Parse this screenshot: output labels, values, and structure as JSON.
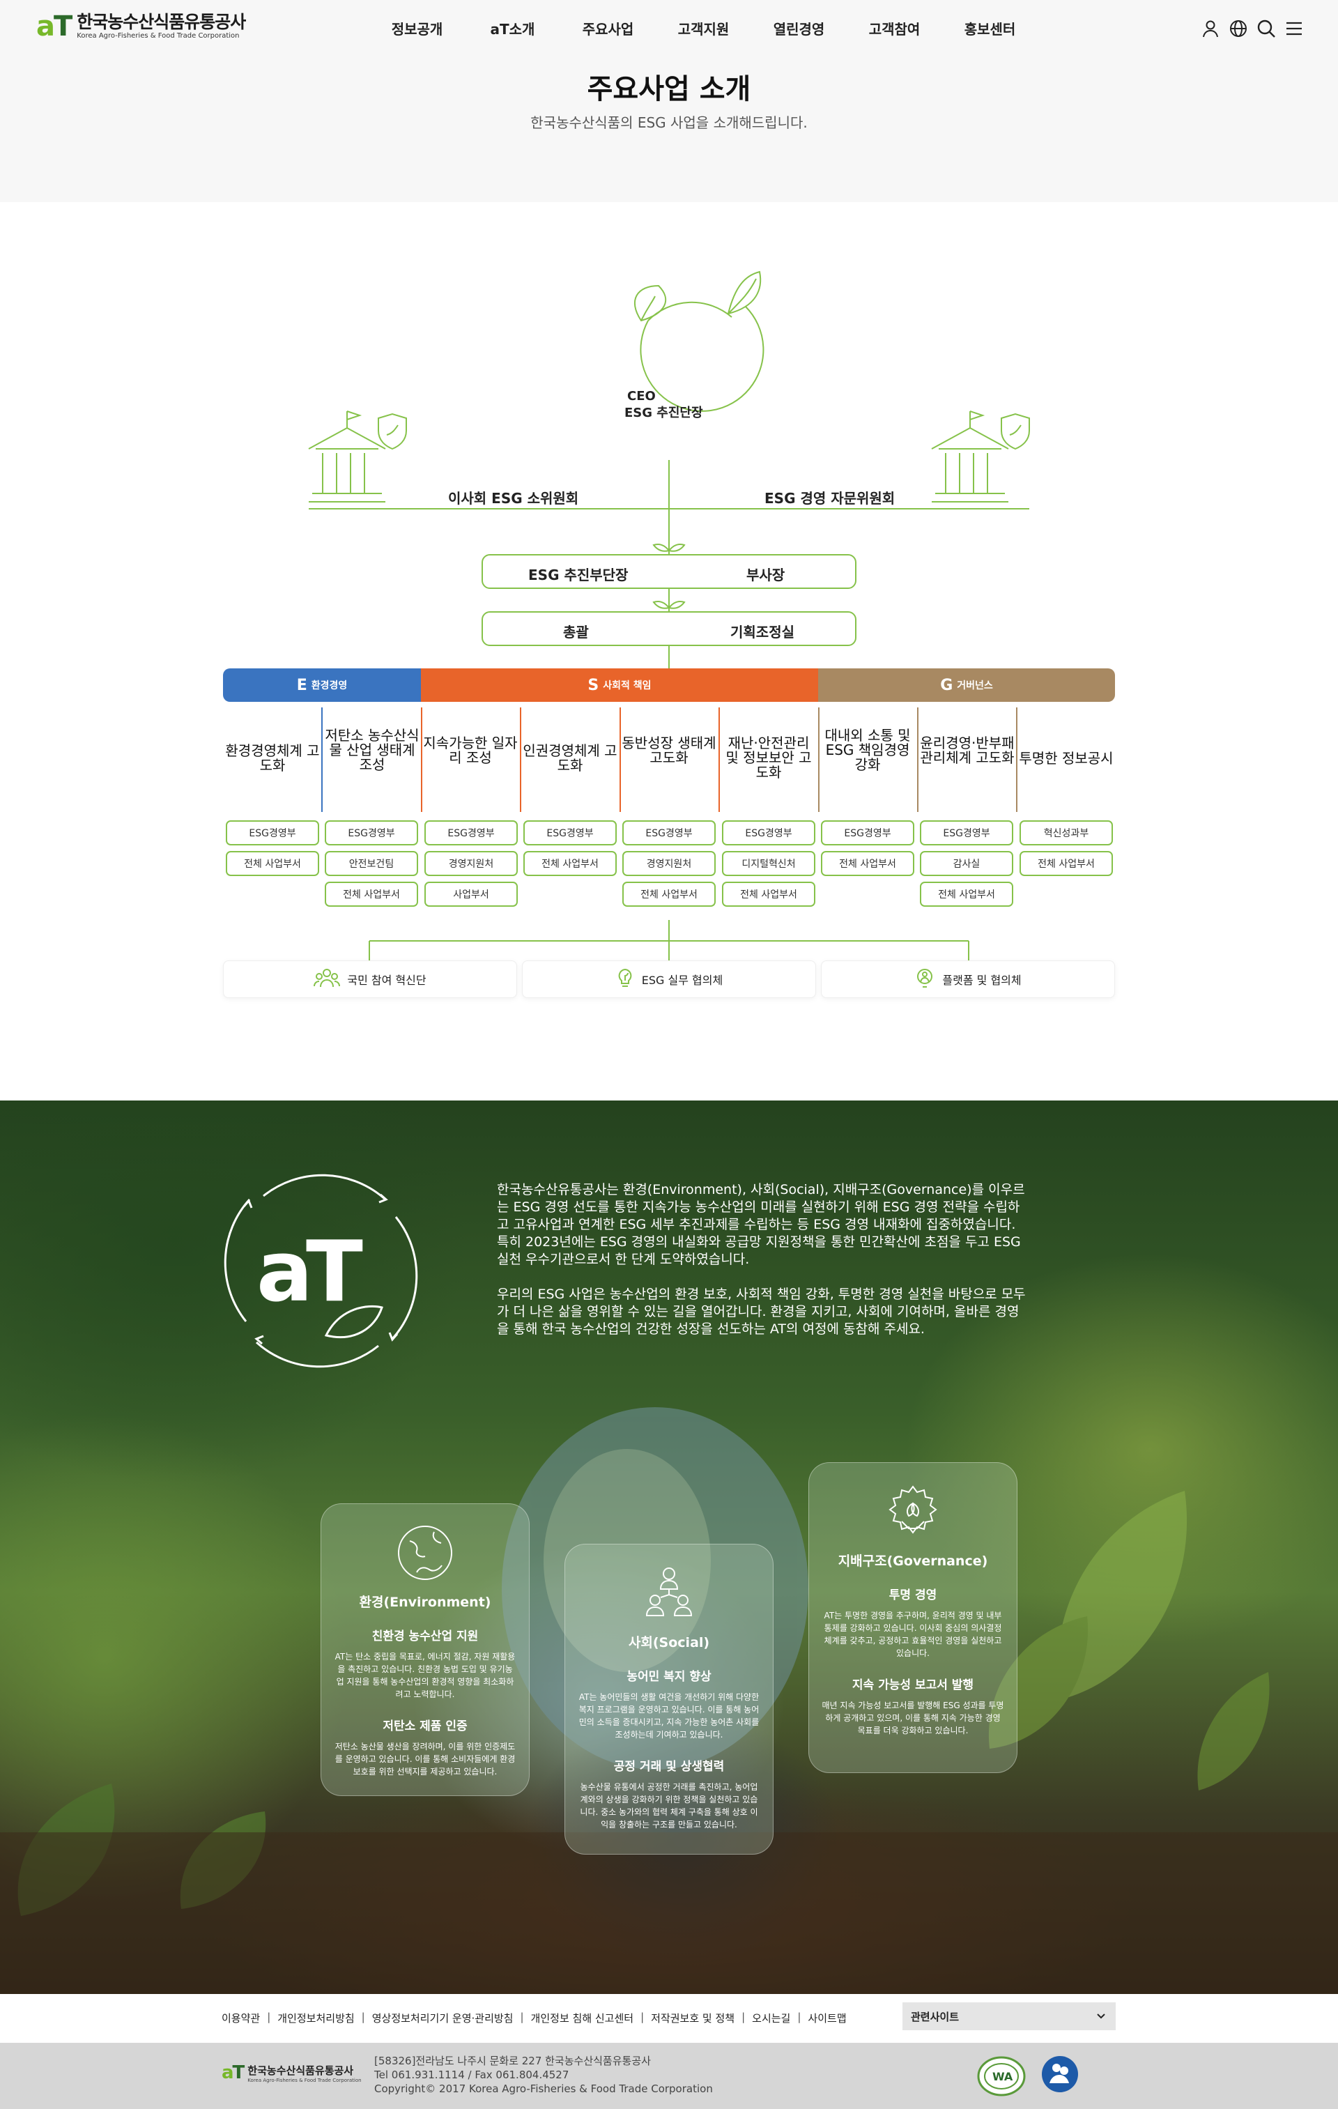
{
  "header": {
    "logo_mark_a": "a",
    "logo_mark_t": "T",
    "logo_ko": "한국농수산식품유통공사",
    "logo_en": "Korea Agro-Fisheries & Food Trade Corporation",
    "nav": [
      "정보공개",
      "aT소개",
      "주요사업",
      "고객지원",
      "열린경영",
      "고객참여",
      "홍보센터"
    ],
    "icons": [
      "user-icon",
      "globe-icon",
      "search-icon",
      "menu-icon"
    ],
    "page_title": "주요사업 소개",
    "page_subtitle": "한국농수산식품의 ESG 사업을 소개해드립니다."
  },
  "org": {
    "ceo_line1": "CEO",
    "ceo_line2": "ESG 추진단장",
    "left_committee": "이사회 ESG 소위원회",
    "right_committee": "ESG 경영 자문위원회",
    "row1_left": "ESG 추진부단장",
    "row1_right": "부사장",
    "row2_left": "총괄",
    "row2_right": "기획조정실",
    "categories": [
      {
        "letter": "E",
        "label": "환경경영",
        "color": "#3a74c0"
      },
      {
        "letter": "S",
        "label": "사회적 책임",
        "color": "#e8642a"
      },
      {
        "letter": "G",
        "label": "거버넌스",
        "color": "#a88962"
      }
    ],
    "tasks": [
      "환경경영체계 고도화",
      "저탄소 농수산식물 산업 생태계 조성",
      "지속가능한 일자리 조성",
      "인권경영체계 고도화",
      "동반성장 생태계 고도화",
      "재난·안전관리 및 정보보안 고도화",
      "대내외 소통 및 ESG 책임경영 강화",
      "윤리경영·반부패 관리체계 고도화",
      "투명한 정보공시"
    ],
    "depts": [
      [
        "ESG경영부",
        "전체 사업부서"
      ],
      [
        "ESG경영부",
        "안전보건팀",
        "전체 사업부서"
      ],
      [
        "ESG경영부",
        "경영지원처",
        "사업부서"
      ],
      [
        "ESG경영부",
        "전체 사업부서"
      ],
      [
        "ESG경영부",
        "경영지원처",
        "전체 사업부서"
      ],
      [
        "ESG경영부",
        "디지털혁신처",
        "전체 사업부서"
      ],
      [
        "ESG경영부",
        "전체 사업부서"
      ],
      [
        "ESG경영부",
        "감사실",
        "전체 사업부서"
      ],
      [
        "혁신성과부",
        "전체 사업부서"
      ]
    ],
    "bottom": [
      "국민 참여 혁신단",
      "ESG 실무 협의체",
      "플랫폼 및 협의체"
    ],
    "accent": "#86c24a"
  },
  "esg": {
    "para1": "한국농수산유통공사는 환경(Environment), 사회(Social), 지배구조(Governance)를 이우르는 ESG 경영 선도를 통한 지속가능 농수산업의 미래를 실현하기 위해 ESG 경영 전략을 수립하고 고유사업과 연계한 ESG 세부 추진과제를 수립하는 등 ESG 경영 내재화에 집중하였습니다. 특히 2023년에는 ESG 경영의 내실화와 공급망 지원정책을 통한 민간확산에 초점을 두고 ESG 실천 우수기관으로서 한 단계 도약하였습니다.",
    "para2": "우리의 ESG 사업은 농수산업의 환경 보호, 사회적 책임 강화, 투명한 경영 실천을 바탕으로 모두가 더 나은 삶을 영위할 수 있는 길을 열어갑니다. 환경을 지키고, 사회에 기여하며, 올바른 경영을 통해 한국 농수산업의 건강한 성장을 선도하는 AT의 여정에 동참해 주세요.",
    "cards": [
      {
        "icon": "globe-icon",
        "title": "환경(Environment)",
        "sub1": "친환경 농수산업 지원",
        "desc1": "AT는 탄소 중립을 목표로, 에너지 절감, 자원 재활용을 촉진하고 있습니다. 친환경 농법 도입 및 유기농업 지원을 통해 농수산업의 환경적 영향을 최소화하려고 노력합니다.",
        "sub2": "저탄소 제품 인증",
        "desc2": "저탄소 농산물 생산을 장려하며, 이를 위한 인증제도를 운영하고 있습니다. 이를 통해 소비자들에게 환경 보호를 위한 선택지를 제공하고 있습니다."
      },
      {
        "icon": "people-icon",
        "title": "사회(Social)",
        "sub1": "농어민 복지 향상",
        "desc1": "AT는 농어민들의 생활 여건을 개선하기 위해 다양한 복지 프로그램을 운영하고 있습니다. 이를 통해 농어민의 소득을 증대시키고, 지속 가능한 농어촌 사회를 조성하는데 기여하고 있습니다.",
        "sub2": "공정 거래 및 상생협력",
        "desc2": "농수산물 유통에서 공정한 거래를 촉진하고, 농어업계와의 상생을 강화하기 위한 정책을 실천하고 있습니다. 중소 농가와의 협력 체계 구축을 통해 상호 이익을 창출하는 구조를 만들고 있습니다."
      },
      {
        "icon": "gear-leaf-icon",
        "title": "지배구조(Governance)",
        "sub1": "투명 경영",
        "desc1": "AT는 투명한 경영을 추구하며, 윤리적 경영 및 내부 통제를 강화하고 있습니다. 이사회 중심의 의사결정 체계를 갖추고, 공정하고 효율적인 경영을 실천하고 있습니다.",
        "sub2": "지속 가능성 보고서 발행",
        "desc2": "매년 지속 가능성 보고서를 발행해 ESG 성과를 투명하게 공개하고 있으며, 이를 통해 지속 가능한 경영 목표를 더욱 강화하고 있습니다."
      }
    ]
  },
  "footer": {
    "links": [
      "이용약관",
      "개인정보처리방침",
      "영상정보처리기기 운영·관리방침",
      "개인정보 침해 신고센터",
      "저작권보호 및 정책",
      "오시는길",
      "사이트맵"
    ],
    "related_sites": "관련사이트",
    "logo_ko": "한국농수산식품유통공사",
    "logo_en": "Korea Agro-Fisheries & Food Trade Corporation",
    "address": "[58326]전라남도 나주시 문화로 227 한국농수산식품유통공사",
    "tel": "Tel 061.931.1114 / Fax 061.804.4527",
    "copyright": "Copyright© 2017 Korea Agro-Fisheries & Food Trade Corporation"
  }
}
